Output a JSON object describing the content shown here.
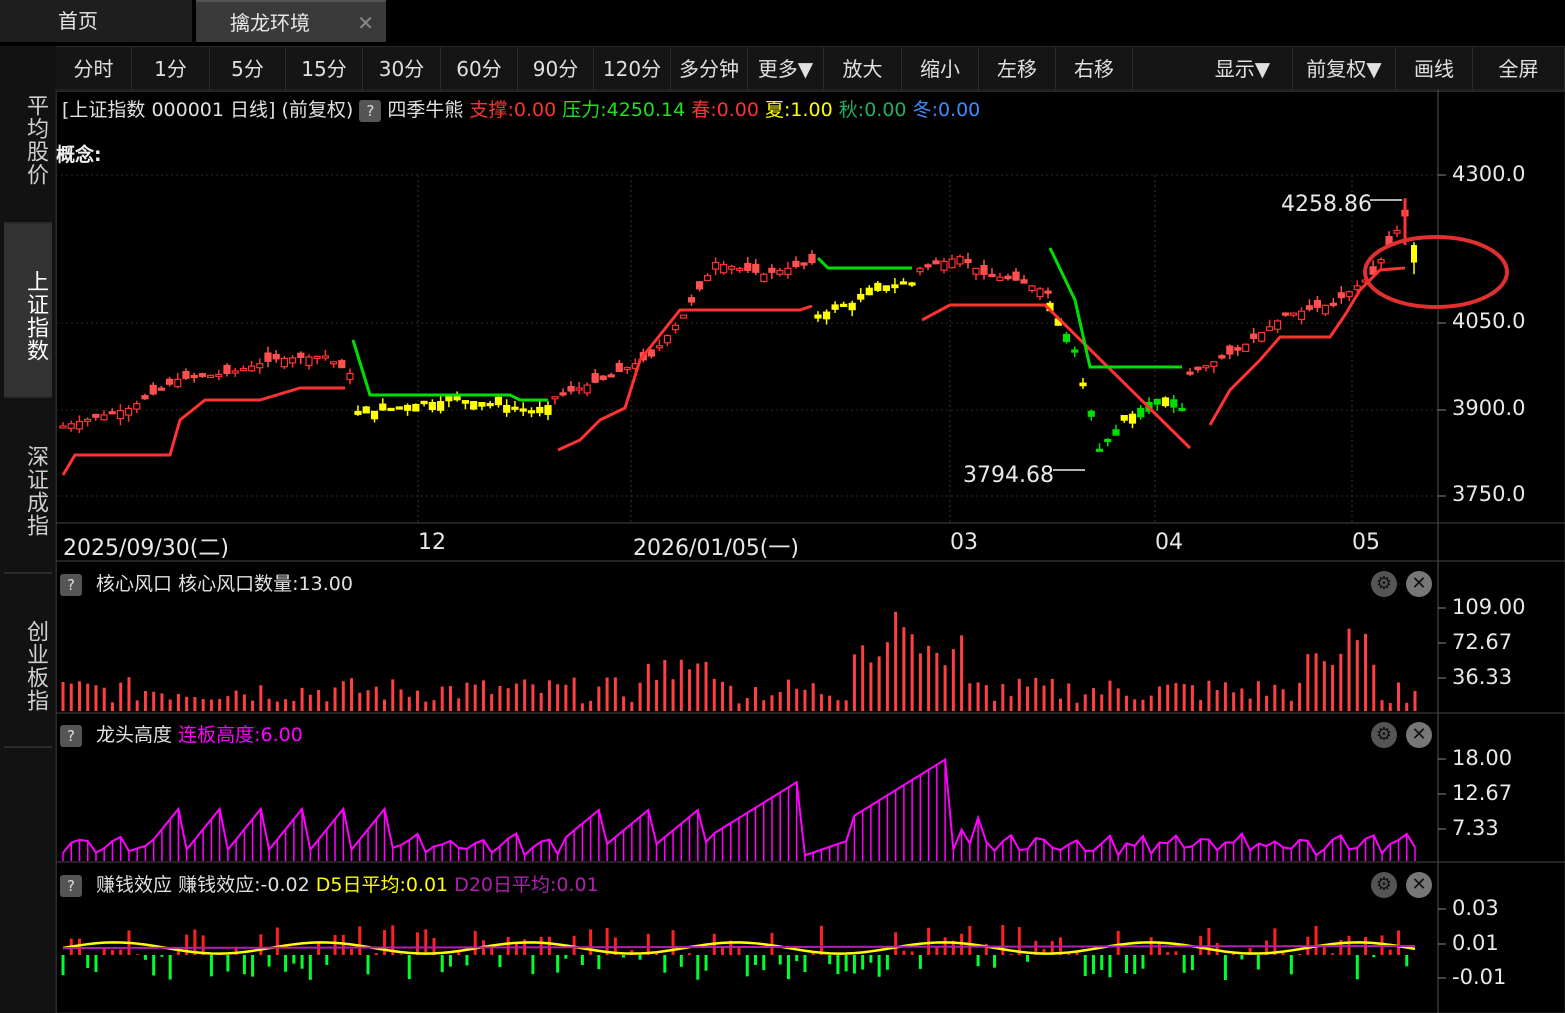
{
  "tabs": {
    "home": "首页",
    "active": "擒龙环境",
    "close": "✕"
  },
  "toolbar": {
    "left": [
      "分时",
      "1分",
      "5分",
      "15分",
      "30分",
      "60分",
      "90分",
      "120分",
      "多分钟",
      "更多▼",
      "放大",
      "缩小",
      "左移",
      "右移"
    ],
    "right": [
      "显示▼",
      "前复权▼",
      "画线",
      "全屏"
    ]
  },
  "sidebar": {
    "items": [
      "平均股价",
      "上证指数",
      "深证成指",
      "创业板指"
    ],
    "active_index": 1
  },
  "info": {
    "title": "[上证指数 000001 日线]",
    "adjust": "(前复权)",
    "help": "?",
    "indicator": "四季牛熊",
    "support": "支撑:0.00",
    "pressure": "压力:4250.14",
    "spring": "春:0.00",
    "summer": "夏:1.00",
    "autumn": "秋:0.00",
    "winter": "冬:0.00",
    "concept": "概念:"
  },
  "colors": {
    "up": "#ff3232",
    "down": "#00e000",
    "yellow": "#ffff00",
    "magenta": "#ff00ff",
    "winter": "#3a8cff",
    "autumn": "#20b060",
    "purple_d20": "#b020b0"
  },
  "main_axis": {
    "ticks": [
      "4300.0",
      "4050.0",
      "3900.0",
      "3750.0"
    ],
    "x_labels": [
      "2025/09/30(二)",
      "12",
      "2026/01/05(一)",
      "03",
      "04",
      "05"
    ],
    "high_label": "4258.86",
    "low_label": "3794.68"
  },
  "panels": {
    "core": {
      "help": "?",
      "title": "核心风口",
      "value_label": "核心风口数量:13.00",
      "ticks": [
        "109.00",
        "72.67",
        "36.33"
      ]
    },
    "dragon": {
      "help": "?",
      "title": "龙头高度",
      "value_label": "连板高度:6.00",
      "ticks": [
        "18.00",
        "12.67",
        "7.33"
      ]
    },
    "money": {
      "help": "?",
      "title": "赚钱效应",
      "value_label": "赚钱效应:-0.02",
      "d5": "D5日平均:0.01",
      "d20": "D20日平均:0.01",
      "ticks": [
        "0.03",
        "0.01",
        "-0.01"
      ]
    }
  },
  "icons": {
    "gear": "gear-icon",
    "close": "close-icon"
  }
}
